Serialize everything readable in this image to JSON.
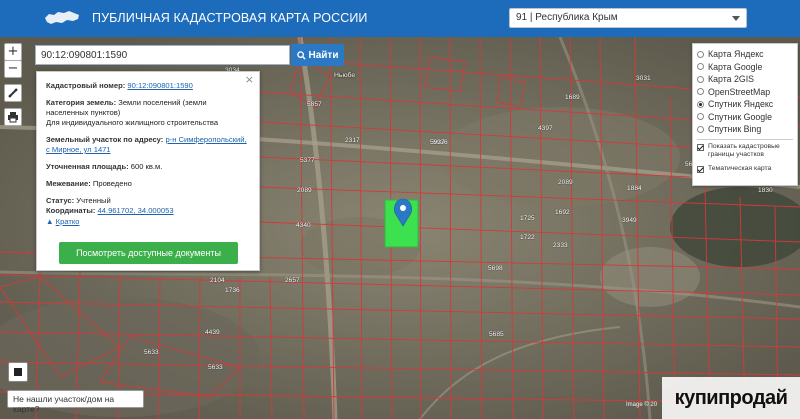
{
  "header": {
    "title": "ПУБЛИЧНАЯ КАДАСТРОВАЯ КАРТА РОССИИ",
    "region": "91 | Республика Крым"
  },
  "search": {
    "value": "90:12:090801:1590",
    "button_label": "Найти"
  },
  "tools": {
    "zoom_in": "+",
    "zoom_out": "−"
  },
  "info": {
    "close": "×",
    "cad_number_label": "Кадастровый номер:",
    "cad_number": "90:12:090801:1590",
    "category_label": "Категория земель:",
    "category_value": "Земли поселений (земли населенных пунктов)",
    "usage_value": "Для индивидуального жилищного строительства",
    "address_label": "Земельный участок по адресу:",
    "address_value": "р-н Симферопольский, с Мирное, ул 1471",
    "area_label": "Уточненная площадь:",
    "area_value": "600 кв.м.",
    "survey_label": "Межевание:",
    "survey_value": "Проведено",
    "status_label": "Статус:",
    "status_value": "Учтенный",
    "coords_label": "Координаты:",
    "coords_value": "44.961702, 34.000053",
    "less_label": "Кратко",
    "docs_button": "Посмотреть доступные документы"
  },
  "layers": {
    "base_maps": [
      {
        "label": "Карта Яндекс",
        "selected": false
      },
      {
        "label": "Карта Google",
        "selected": false
      },
      {
        "label": "Карта 2GIS",
        "selected": false
      },
      {
        "label": "OpenStreetMap",
        "selected": false
      },
      {
        "label": "Спутник Яндекс",
        "selected": true
      },
      {
        "label": "Спутник Google",
        "selected": false
      },
      {
        "label": "Спутник Bing",
        "selected": false
      }
    ],
    "overlays": [
      {
        "label": "Показать кадастровые границы участков",
        "checked": true
      },
      {
        "label": "Тематическая карта",
        "checked": true
      }
    ]
  },
  "bottom": {
    "not_found": "Не нашли участок/дом на карте?",
    "copyright": "Image © 20",
    "watermark": "купипродай"
  },
  "map": {
    "place": "Ньюбе",
    "parcels": [
      "5857",
      "3034",
      "5936",
      "2317",
      "1689",
      "4397",
      "5937",
      "5377",
      "5699",
      "2089",
      "1884",
      "4340",
      "2089",
      "1692",
      "1725",
      "2333",
      "3949",
      "5698",
      "1722",
      "2657",
      "4439",
      "5633",
      "5685",
      "5633",
      "3031",
      "2104",
      "1736",
      "1830"
    ]
  },
  "colors": {
    "header_bg": "#1d6cbb",
    "parcel_boundary": "#d23a3a",
    "selected_parcel": "#3de04e",
    "docs_button": "#3bb04a",
    "link": "#1d63b0"
  }
}
